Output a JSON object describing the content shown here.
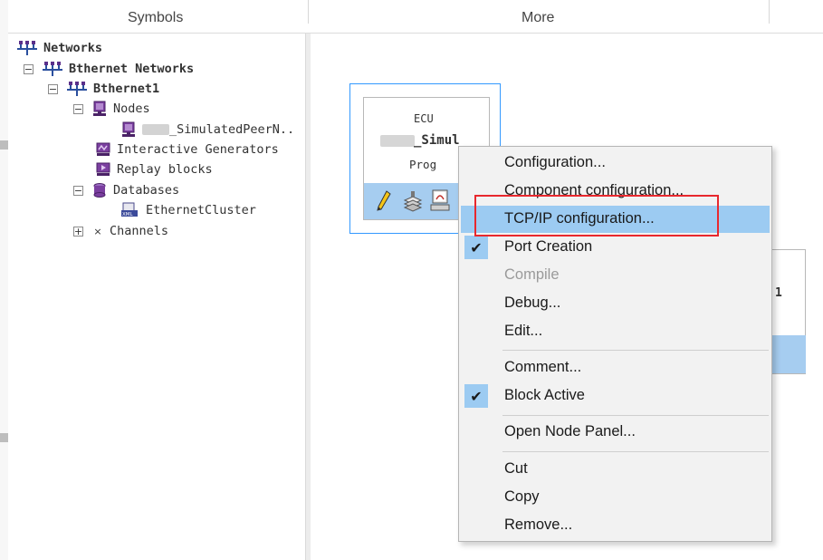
{
  "header": {
    "symbols_label": "Symbols",
    "more_label": "More"
  },
  "tree": {
    "networks": "Networks",
    "ethernet_networks": "Bthernet Networks",
    "ethernet1": "Bthernet1",
    "nodes": "Nodes",
    "simulated_peer": "_SimulatedPeerN..",
    "interactive_generators": "Interactive Generators",
    "replay_blocks": "Replay blocks",
    "databases": "Databases",
    "ethernet_cluster": "EthernetCluster",
    "channels": "Channels",
    "collapse_glyph": "−",
    "expand_glyph": "+",
    "channels_glyph": "×"
  },
  "node_block": {
    "type_label": "ECU",
    "name_label": "_Simul",
    "prog_label": "Prog"
  },
  "node2": {
    "text": "1"
  },
  "context_menu": {
    "items": [
      {
        "label": "Configuration...",
        "enabled": true,
        "checked": false,
        "highlighted": false
      },
      {
        "label": "Component configuration...",
        "enabled": true,
        "checked": false,
        "highlighted": false
      },
      {
        "label": "TCP/IP configuration...",
        "enabled": true,
        "checked": false,
        "highlighted": true
      },
      {
        "label": "Port Creation",
        "enabled": true,
        "checked": true,
        "highlighted": false
      },
      {
        "label": "Compile",
        "enabled": false,
        "checked": false,
        "highlighted": false
      },
      {
        "label": "Debug...",
        "enabled": true,
        "checked": false,
        "highlighted": false
      },
      {
        "label": "Edit...",
        "enabled": true,
        "checked": false,
        "highlighted": false
      },
      {
        "label": "Comment...",
        "enabled": true,
        "checked": false,
        "highlighted": false
      },
      {
        "label": "Block Active",
        "enabled": true,
        "checked": true,
        "highlighted": false
      },
      {
        "label": "Open Node Panel...",
        "enabled": true,
        "checked": false,
        "highlighted": false
      },
      {
        "label": "Cut",
        "enabled": true,
        "checked": false,
        "highlighted": false
      },
      {
        "label": "Copy",
        "enabled": true,
        "checked": false,
        "highlighted": false
      },
      {
        "label": "Remove...",
        "enabled": true,
        "checked": false,
        "highlighted": false
      }
    ],
    "check_glyph": "✔"
  },
  "colors": {
    "highlight": "#9ccbf2",
    "selection_border": "#3399ff",
    "annotation": "#e8282e",
    "toolbar": "#a6cdf0"
  }
}
